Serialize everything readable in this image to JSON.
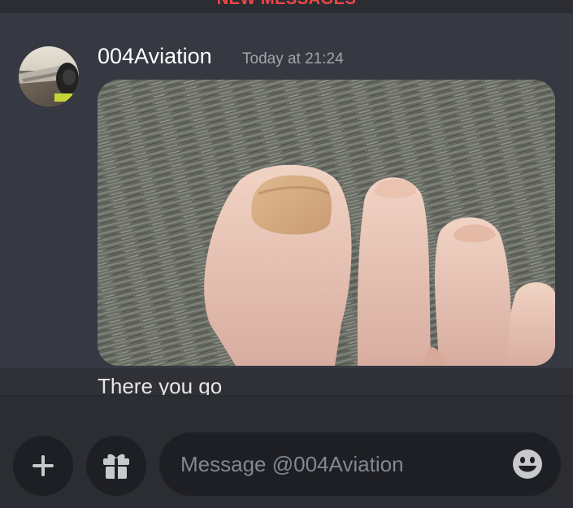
{
  "banner": {
    "new_messages_label": "NEW MESSAGES"
  },
  "message": {
    "author": "004Aviation",
    "timestamp": "Today at 21:24",
    "text": "There you go",
    "attachment": "photo of toes",
    "avatar_icon": "user-avatar"
  },
  "composer": {
    "placeholder": "Message @004Aviation",
    "add_icon": "plus-icon",
    "gift_icon": "gift-icon",
    "emoji_icon": "emoji-icon"
  },
  "colors": {
    "background": "#363842",
    "composer_bg": "#2b2d33",
    "input_bg": "#1e1f24",
    "new_messages": "#f04747",
    "username": "#ffffff",
    "timestamp": "#a3a6ad"
  }
}
